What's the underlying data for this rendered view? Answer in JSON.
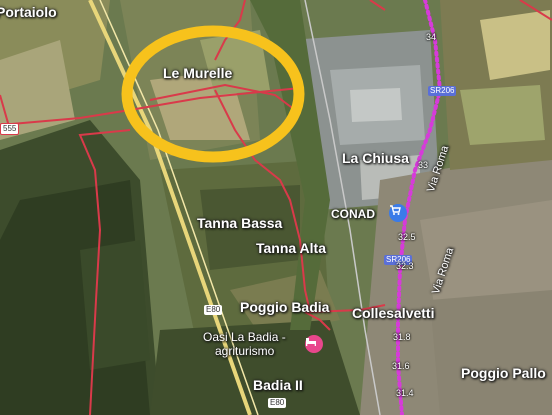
{
  "colors": {
    "highlight_circle": "#f7c21c",
    "admin_boundary": "#d93a4a",
    "railway_dotted": "#d63bd9",
    "railway_track": "#b36be8",
    "highway": "#e8d67a",
    "shop_pin": "#3a7be8",
    "hotel_pin": "#e8478c"
  },
  "places": {
    "portaiolo": "Portaiolo",
    "le_murelle": "Le Murelle",
    "la_chiusa": "La Chiusa",
    "tanna_bassa": "Tanna Bassa",
    "tanna_alta": "Tanna Alta",
    "poggio_badia": "Poggio Badia",
    "collesalvetti": "Collesalvetti",
    "badia_ii": "Badia II",
    "poggio_pallone": "Poggio Pallo",
    "oasi_line1": "Oasi La Badia -",
    "oasi_line2": "agriturismo",
    "conad": "CONAD",
    "via_roma_1": "Via Roma",
    "via_roma_2": "Via Roma"
  },
  "road_badges": {
    "sr206_a": "SR206",
    "sr206_b": "SR206",
    "e80_a": "E80",
    "e80_b": "E80",
    "r555": "555"
  },
  "km_markers": [
    "34",
    "33",
    "32.5",
    "32.3",
    "31.8",
    "31.6",
    "31.4"
  ],
  "icons": {
    "shop": "shopping-cart-icon",
    "hotel": "bed-icon"
  }
}
